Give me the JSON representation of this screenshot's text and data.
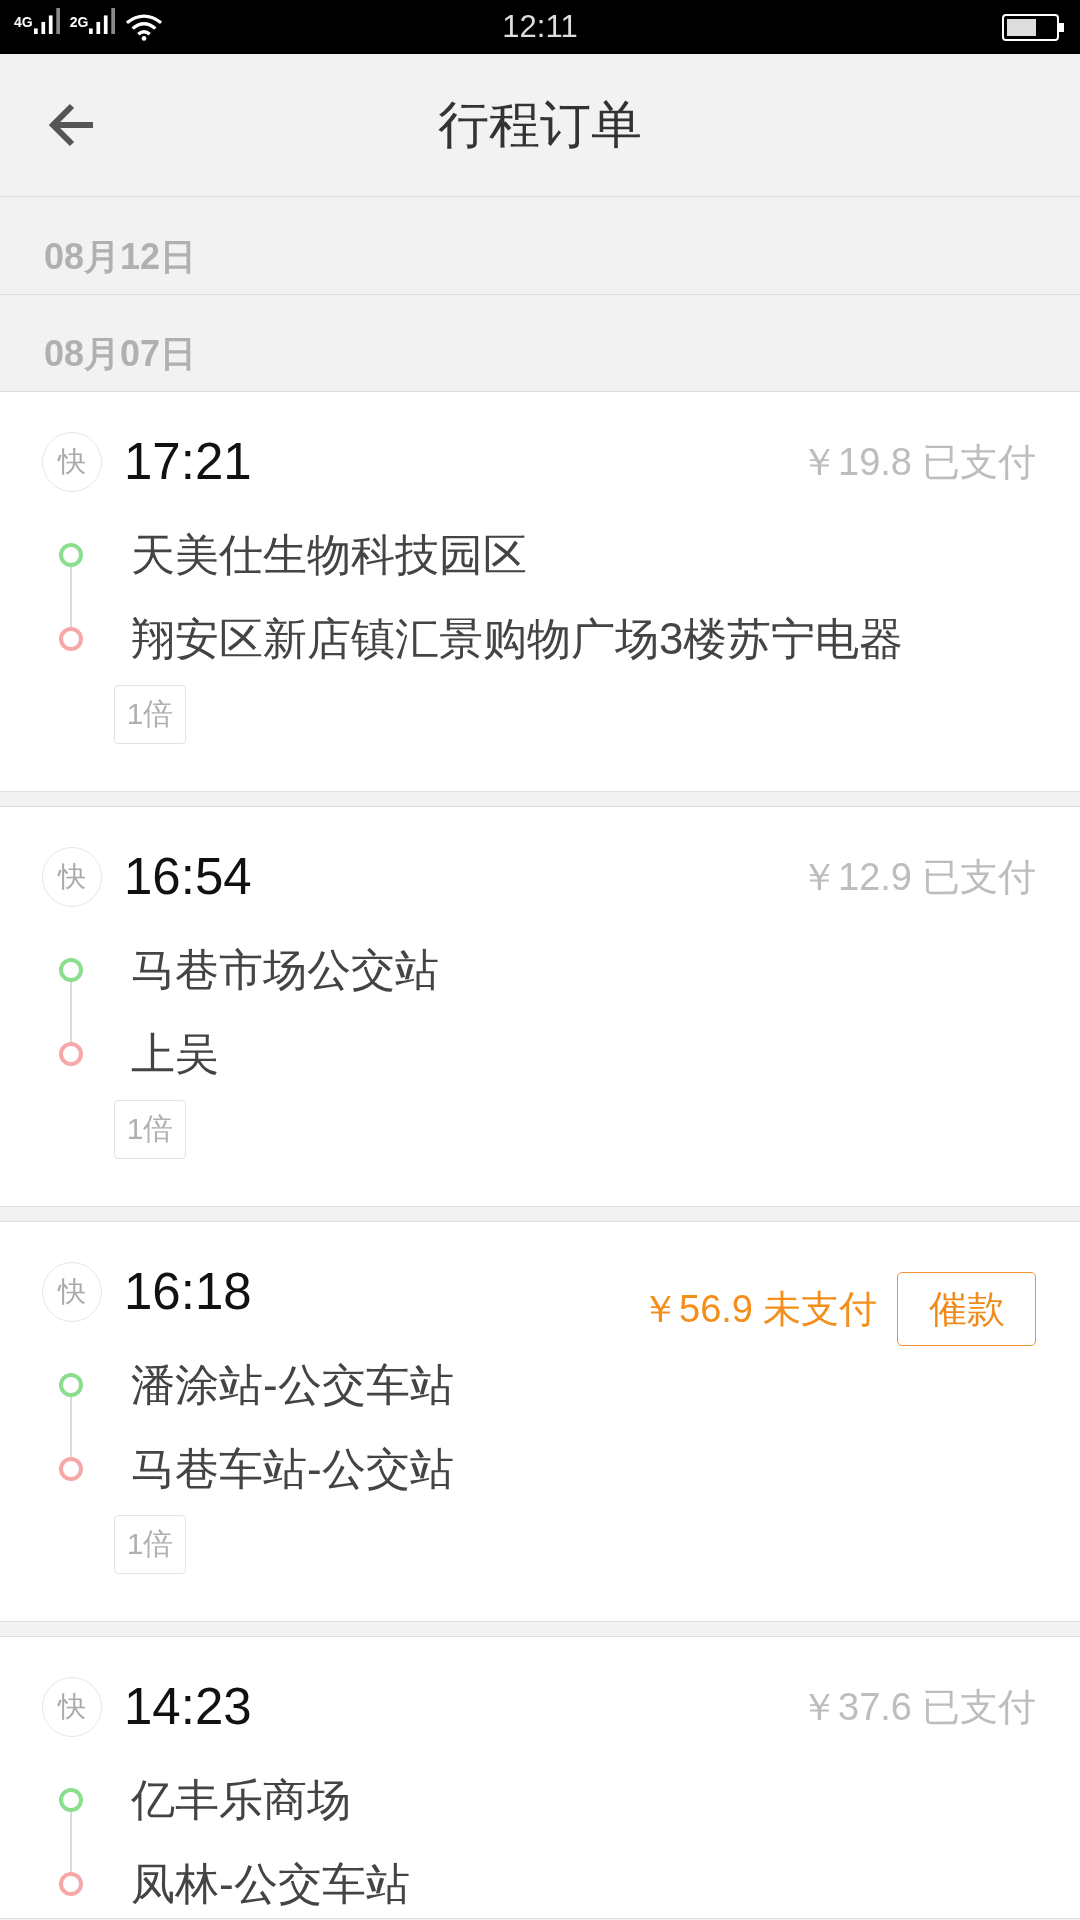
{
  "status_bar": {
    "networks": [
      "4G",
      "2G"
    ],
    "time": "12:11"
  },
  "header": {
    "title": "行程订单"
  },
  "date_groups": [
    {
      "date": "08月12日"
    },
    {
      "date": "08月07日",
      "orders": [
        {
          "type_badge": "快",
          "time": "17:21",
          "amount": "￥19.8",
          "payment_status": "已支付",
          "paid": true,
          "origin": "天美仕生物科技园区",
          "destination": "翔安区新店镇汇景购物广场3楼苏宁电器",
          "multiplier": "1倍"
        },
        {
          "type_badge": "快",
          "time": "16:54",
          "amount": "￥12.9",
          "payment_status": "已支付",
          "paid": true,
          "origin": "马巷市场公交站",
          "destination": "上吴",
          "multiplier": "1倍"
        },
        {
          "type_badge": "快",
          "time": "16:18",
          "amount": "￥56.9",
          "payment_status": "未支付",
          "paid": false,
          "action_button": "催款",
          "origin": "潘涂站-公交车站",
          "destination": "马巷车站-公交站",
          "multiplier": "1倍"
        },
        {
          "type_badge": "快",
          "time": "14:23",
          "amount": "￥37.6",
          "payment_status": "已支付",
          "paid": true,
          "origin": "亿丰乐商场",
          "destination": "凤林-公交车站"
        }
      ]
    }
  ]
}
